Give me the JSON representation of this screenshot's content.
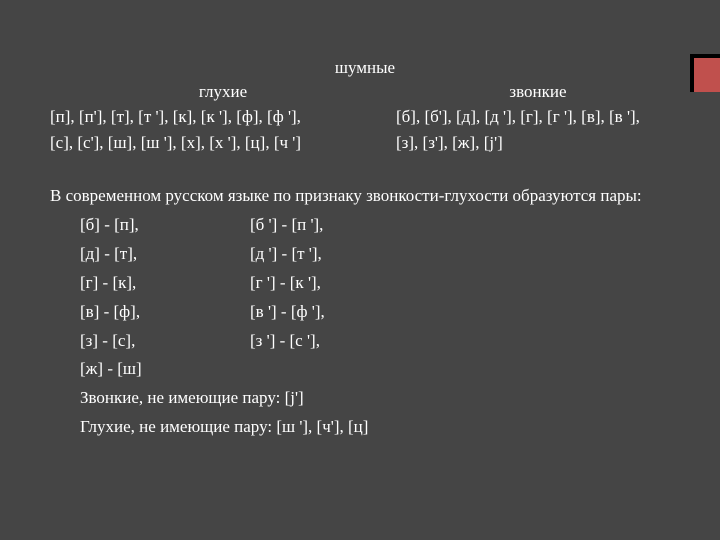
{
  "title": "шумные",
  "cols": {
    "left": {
      "head": "глухие",
      "l1": "[п], [п'], [т], [т '], [к], [к '], [ф], [ф '],",
      "l2": "[с], [с'], [ш], [ш '], [х], [х '], [ц], [ч ']"
    },
    "right": {
      "head": "звонкие",
      "l1": "[б], [б'], [д], [д '], [г], [г '], [в], [в '],",
      "l2": "[з], [з'], [ж], [j']"
    }
  },
  "para": "В современном русском языке по признаку звонкости-глухости образуются пары:",
  "pairs": [
    {
      "a": "[б] - [п],",
      "b": "[б '] - [п '],"
    },
    {
      "a": "[д] - [т],",
      "b": "[д '] - [т '],"
    },
    {
      "a": "[г] - [к],",
      "b": "[г '] - [к '],"
    },
    {
      "a": "[в] - [ф],",
      "b": "[в '] - [ф '],"
    },
    {
      "a": "[з] - [с],",
      "b": "[з '] - [с '],"
    },
    {
      "a": "[ж] - [ш]",
      "b": ""
    }
  ],
  "tail1": "Звонкие, не имеющие пару: [j']",
  "tail2": "Глухие, не имеющие пару: [ш '], [ч'], [ц]"
}
